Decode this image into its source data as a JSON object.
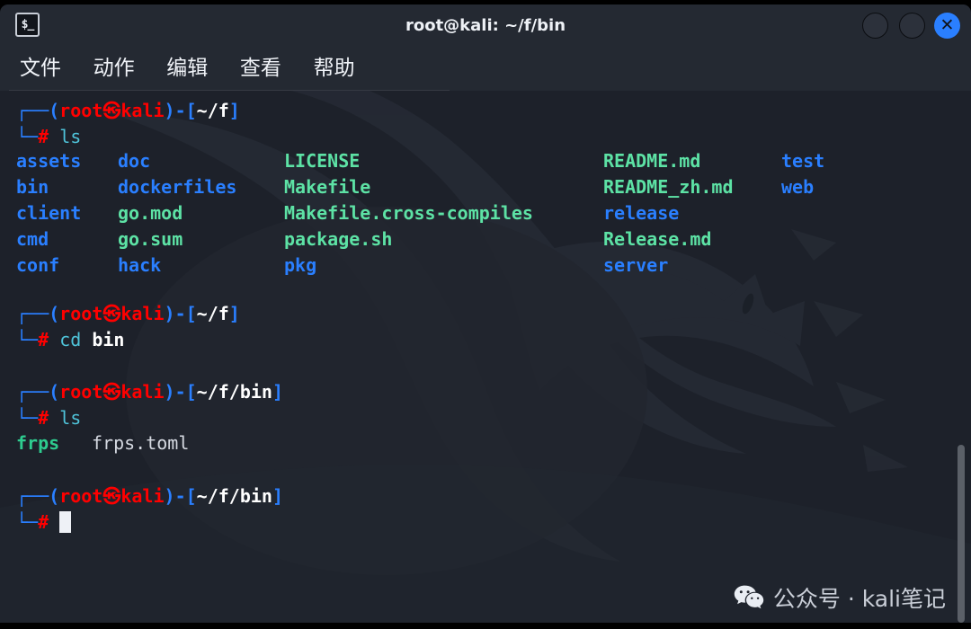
{
  "window": {
    "title": "root@kali: ~/f/bin",
    "icon_name": "terminal-icon",
    "icon_glyph": "$_",
    "controls": {
      "minimize_label": "",
      "maximize_label": "",
      "close_label": "✕"
    },
    "colors": {
      "titlebar_bg": "#242932",
      "terminal_bg": "#1d212a",
      "close_button": "#2a7fff",
      "dir_color": "#2a7fff",
      "file_color": "#5de2a5",
      "prompt_red": "#ff0000",
      "command_cyan": "#4fc3d9"
    }
  },
  "menubar": {
    "items": [
      {
        "label": "文件"
      },
      {
        "label": "动作"
      },
      {
        "label": "编辑"
      },
      {
        "label": "查看"
      },
      {
        "label": "帮助"
      }
    ]
  },
  "terminal": {
    "prompt": {
      "top_corner": "┌──",
      "bot_corner": "└─",
      "open_paren": "(",
      "user": "root",
      "at_symbol": "㉿",
      "host": "kali",
      "close_paren": ")",
      "dash": "-",
      "open_bracket": "[",
      "close_bracket": "]",
      "hash": "#"
    },
    "blocks": [
      {
        "path": "~/f",
        "command_name": "ls",
        "command_arg": ""
      },
      {
        "path": "~/f",
        "command_name": "cd",
        "command_arg": "bin"
      },
      {
        "path": "~/f/bin",
        "command_name": "ls",
        "command_arg": ""
      },
      {
        "path": "~/f/bin",
        "command_name": "",
        "command_arg": ""
      }
    ],
    "ls_output_root": {
      "columns": [
        {
          "entries": [
            {
              "name": "assets",
              "kind": "dir"
            },
            {
              "name": "bin",
              "kind": "dir"
            },
            {
              "name": "client",
              "kind": "dir"
            },
            {
              "name": "cmd",
              "kind": "dir"
            },
            {
              "name": "conf",
              "kind": "dir"
            }
          ]
        },
        {
          "entries": [
            {
              "name": "doc",
              "kind": "dir"
            },
            {
              "name": "dockerfiles",
              "kind": "dir"
            },
            {
              "name": "go.mod",
              "kind": "file"
            },
            {
              "name": "go.sum",
              "kind": "file"
            },
            {
              "name": "hack",
              "kind": "dir"
            }
          ]
        },
        {
          "entries": [
            {
              "name": "LICENSE",
              "kind": "file"
            },
            {
              "name": "Makefile",
              "kind": "file"
            },
            {
              "name": "Makefile.cross-compiles",
              "kind": "file"
            },
            {
              "name": "package.sh",
              "kind": "file"
            },
            {
              "name": "pkg",
              "kind": "dir"
            }
          ]
        },
        {
          "entries": [
            {
              "name": "README.md",
              "kind": "file"
            },
            {
              "name": "README_zh.md",
              "kind": "file"
            },
            {
              "name": "release",
              "kind": "dir"
            },
            {
              "name": "Release.md",
              "kind": "file"
            },
            {
              "name": "server",
              "kind": "dir"
            }
          ]
        },
        {
          "entries": [
            {
              "name": "test",
              "kind": "dir"
            },
            {
              "name": "web",
              "kind": "dir"
            }
          ]
        }
      ]
    },
    "ls_output_bin": {
      "entries": [
        {
          "name": "frps",
          "kind": "exe"
        },
        {
          "name": "frps.toml",
          "kind": "plain"
        }
      ]
    },
    "cursor": {
      "visible": true
    }
  },
  "overlay": {
    "wechat_label": "公众号 · kali笔记",
    "wechat_icon_name": "wechat-icon"
  },
  "scrollbar": {
    "orientation": "vertical",
    "thumb_top_pct": 67,
    "thumb_height_pct": 33
  }
}
